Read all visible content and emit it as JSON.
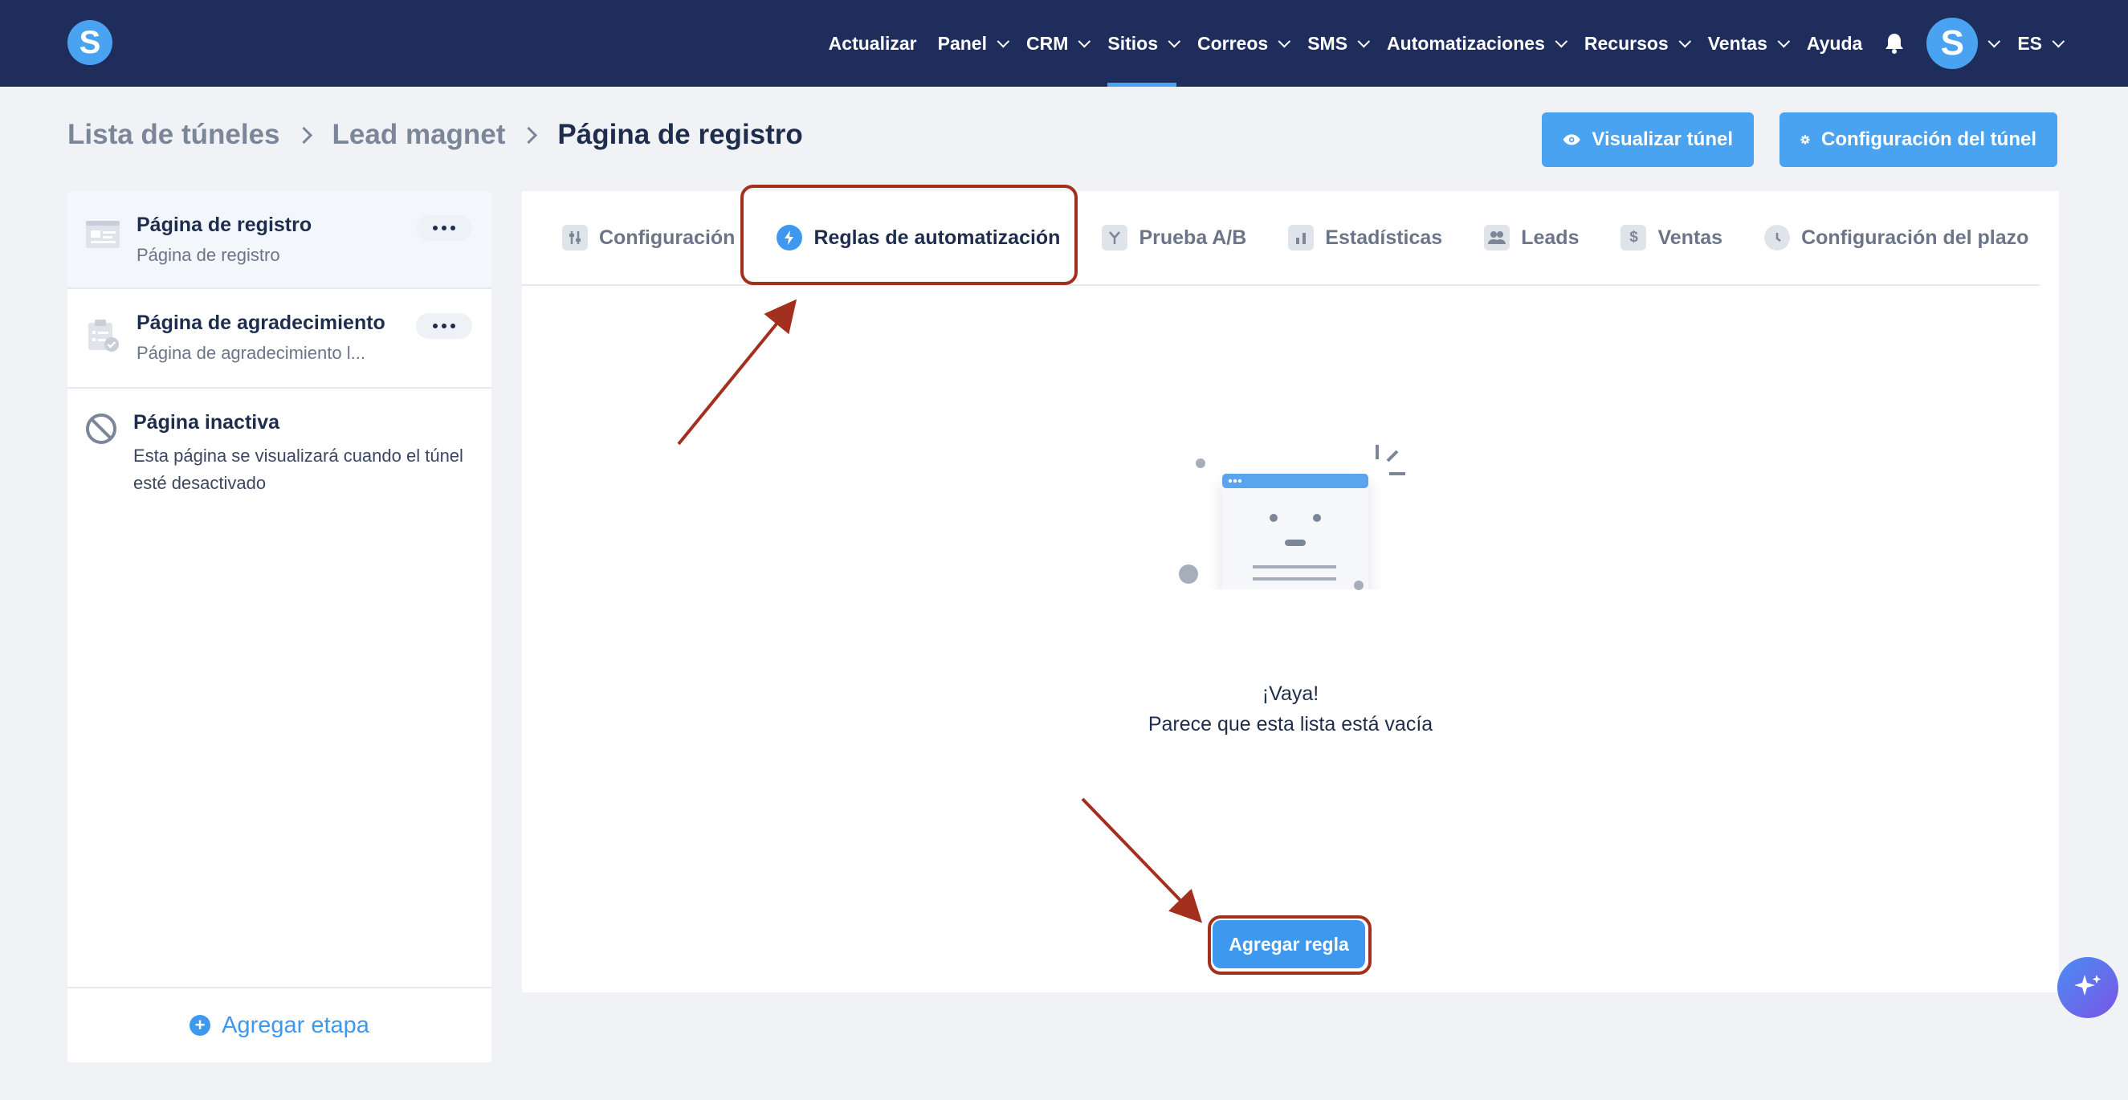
{
  "nav": {
    "items": [
      {
        "label": "Actualizar",
        "dropdown": false
      },
      {
        "label": "Panel",
        "dropdown": true
      },
      {
        "label": "CRM",
        "dropdown": true
      },
      {
        "label": "Sitios",
        "dropdown": true,
        "active": true
      },
      {
        "label": "Correos",
        "dropdown": true
      },
      {
        "label": "SMS",
        "dropdown": true
      },
      {
        "label": "Automatizaciones",
        "dropdown": true
      },
      {
        "label": "Recursos",
        "dropdown": true
      },
      {
        "label": "Ventas",
        "dropdown": true
      },
      {
        "label": "Ayuda",
        "dropdown": false
      }
    ],
    "avatar_letter": "S",
    "language": "ES",
    "logo_letter": "S"
  },
  "breadcrumb": {
    "items": [
      "Lista de túneles",
      "Lead magnet"
    ],
    "current": "Página de registro"
  },
  "actions": {
    "visualize_label": "Visualizar túnel",
    "config_label": "Configuración del túnel"
  },
  "stages": [
    {
      "title": "Página de registro",
      "subtitle": "Página de registro"
    },
    {
      "title": "Página de agradecimiento",
      "subtitle": "Página de agradecimiento l..."
    },
    {
      "title": "Página inactiva",
      "description": "Esta página se visualizará cuando el túnel esté desactivado"
    }
  ],
  "add_stage_label": "Agregar etapa",
  "tabs": [
    {
      "label": "Configuración",
      "icon": "sliders-icon"
    },
    {
      "label": "Reglas de automatización",
      "icon": "lightning-icon",
      "active": true
    },
    {
      "label": "Prueba A/B",
      "icon": "split-icon"
    },
    {
      "label": "Estadísticas",
      "icon": "bar-chart-icon"
    },
    {
      "label": "Leads",
      "icon": "users-icon"
    },
    {
      "label": "Ventas",
      "icon": "dollar-icon"
    },
    {
      "label": "Configuración del plazo",
      "icon": "clock-icon"
    }
  ],
  "empty_state": {
    "title": "¡Vaya!",
    "subtitle": "Parece que esta lista está vacía"
  },
  "add_rule_label": "Agregar regla",
  "colors": {
    "topbar": "#1f2d5c",
    "accent": "#4aa3f0",
    "annotation": "#a3301f"
  }
}
